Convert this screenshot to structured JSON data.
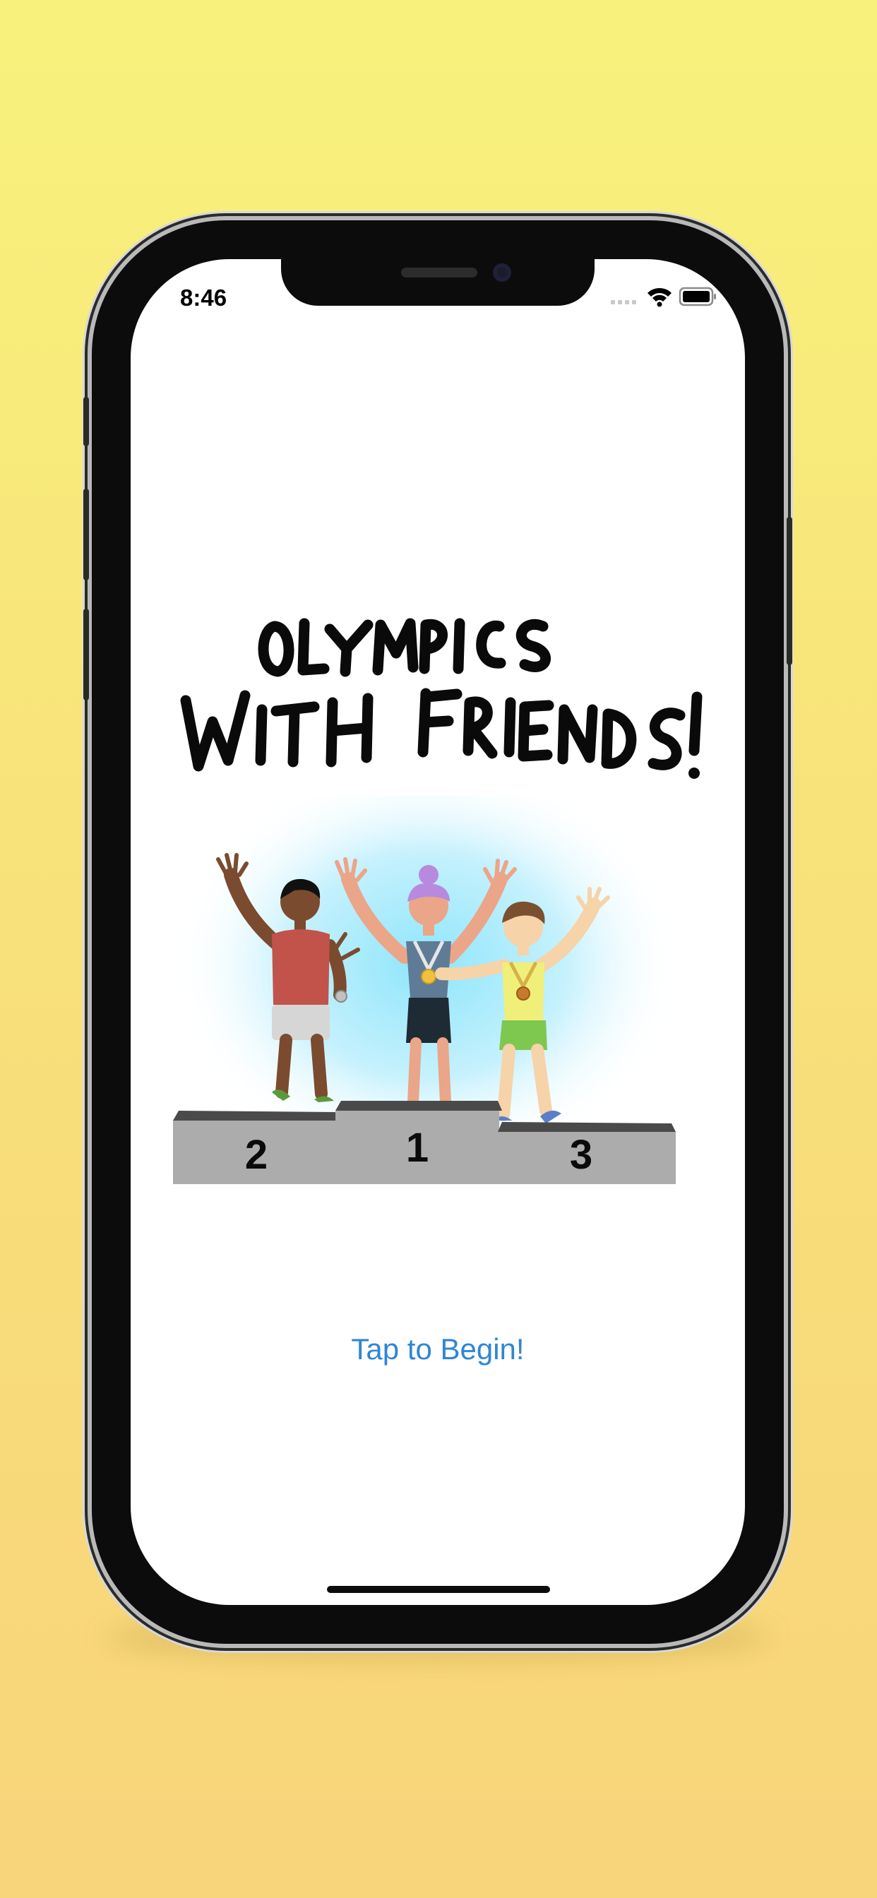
{
  "status_bar": {
    "time": "8:46"
  },
  "app": {
    "title_line1": "OLYMPICS",
    "title_line2": "WITH FRIENDS!",
    "podium": {
      "first": "1",
      "second": "2",
      "third": "3"
    },
    "begin_label": "Tap to Begin!"
  },
  "colors": {
    "background_top": "#f8f27c",
    "background_bottom": "#f8d47a",
    "accent": "#2f86d6",
    "podium": "#acacac"
  }
}
